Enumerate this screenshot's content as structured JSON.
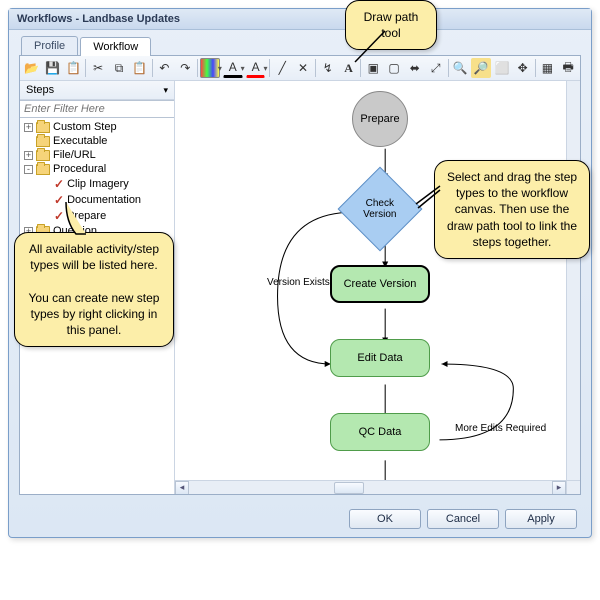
{
  "window": {
    "title": "Workflows - Landbase Updates"
  },
  "tabs": {
    "profile": "Profile",
    "workflow": "Workflow",
    "active": "workflow"
  },
  "toolbar_icons": [
    "open-icon",
    "save-icon",
    "paste-icon",
    "sep",
    "cut-icon",
    "copy-icon",
    "paste2-icon",
    "sep",
    "undo-icon",
    "redo-icon",
    "sep",
    "fillcolor-icon",
    "linecolor-icon",
    "textcolor-icon",
    "sep",
    "line-icon",
    "arrow-icon",
    "delete-icon",
    "sep",
    "drawpath-icon",
    "text-icon",
    "sep",
    "group-icon",
    "ungroup-icon",
    "align-icon",
    "fit-icon",
    "sep",
    "zoomin-icon",
    "zoomout-icon",
    "zoomfit-icon",
    "pan-icon",
    "sep",
    "help-icon",
    "print-icon"
  ],
  "sidebar": {
    "header": "Steps",
    "filter_placeholder": "Enter Filter Here",
    "items": [
      {
        "label": "Custom Step",
        "icon": "folder",
        "expander": "+",
        "indent": 0
      },
      {
        "label": "Executable",
        "icon": "folder",
        "expander": "",
        "indent": 0
      },
      {
        "label": "File/URL",
        "icon": "folder",
        "expander": "+",
        "indent": 0
      },
      {
        "label": "Procedural",
        "icon": "folder",
        "expander": "-",
        "indent": 0
      },
      {
        "label": "Clip Imagery",
        "icon": "check",
        "expander": "",
        "indent": 1
      },
      {
        "label": "Documentation",
        "icon": "check",
        "expander": "",
        "indent": 1
      },
      {
        "label": "Prepare",
        "icon": "check",
        "expander": "",
        "indent": 1
      },
      {
        "label": "Question",
        "icon": "folder",
        "expander": "+",
        "indent": 0
      }
    ]
  },
  "nodes": {
    "prepare": "Prepare",
    "check_version": "Check\nVersion",
    "create_version": "Create Version",
    "edit_data": "Edit Data",
    "qc_data": "QC Data"
  },
  "edge_labels": {
    "version_exists": "Version Exists",
    "more_edits": "More Edits Required"
  },
  "buttons": {
    "ok": "OK",
    "cancel": "Cancel",
    "apply": "Apply"
  },
  "callouts": {
    "drawpath": "Draw path\ntool",
    "sidebar": "All available activity/step types will be listed here.\n\nYou can create new step types by right clicking in this panel.",
    "canvas": "Select and drag the step types to the workflow canvas. Then use the draw path tool to link the steps together."
  }
}
